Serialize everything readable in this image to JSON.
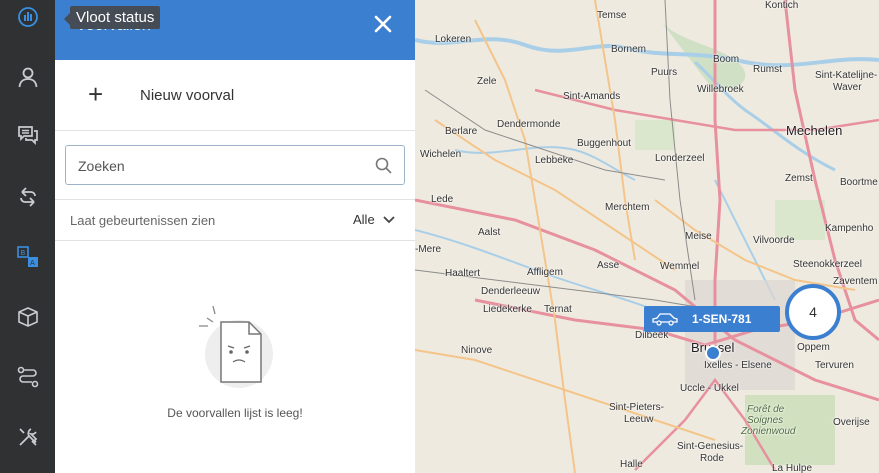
{
  "panel": {
    "title": "Voorvallen",
    "tooltip": "Vloot status",
    "new_label": "Nieuw voorval",
    "search_placeholder": "Zoeken",
    "filter_label": "Laat gebeurtenissen zien",
    "filter_value": "Alle",
    "empty_text": "De voorvallen lijst is leeg!"
  },
  "colors": {
    "accent": "#3b7fd0",
    "rail": "#2f3133",
    "rail_icon": "#c9ccd0",
    "rail_active": "#3b8fe0"
  },
  "rail_icons": [
    "chart-icon",
    "user-icon",
    "chat-icon",
    "refresh-icon",
    "translate-icon",
    "box-icon",
    "route-icon",
    "tools-icon"
  ],
  "map": {
    "places": [
      "Temse",
      "Kontich",
      "Lokeren",
      "Boom",
      "Rumst",
      "Bornem",
      "Sint-Katelijne-",
      "Waver",
      "Zele",
      "Puurs",
      "Willebroek",
      "Sint-Amands",
      "Dendermonde",
      "Berlare",
      "Mechelen",
      "Buggenhout",
      "Wichelen",
      "Lebbeke",
      "Londerzeel",
      "Zemst",
      "Boortme",
      "Lede",
      "Merchtem",
      "Aalst",
      "Meise",
      "Vilvoorde",
      "Kampenho",
      "-Mere",
      "Wemmel",
      "Steenokkerzeel",
      "Haaltert",
      "Affligem",
      "Asse",
      "Zaventem",
      "Denderleeuw",
      "Liedekerke",
      "Ternat",
      "Dilbeek",
      "Brussel",
      "Oppem",
      "Ninove",
      "Ixelles - Elsene",
      "Uccle - Ukkel",
      "Tervuren",
      "Sint-Pieters-",
      "Leeuw",
      "Forêt de",
      "Soignes",
      "Zonienwoud",
      "Overijse",
      "Sint-Genesius-",
      "Rode",
      "Halle",
      "La Hulpe"
    ],
    "vehicle_plate": "1-SEN-781",
    "cluster_count": "4"
  }
}
